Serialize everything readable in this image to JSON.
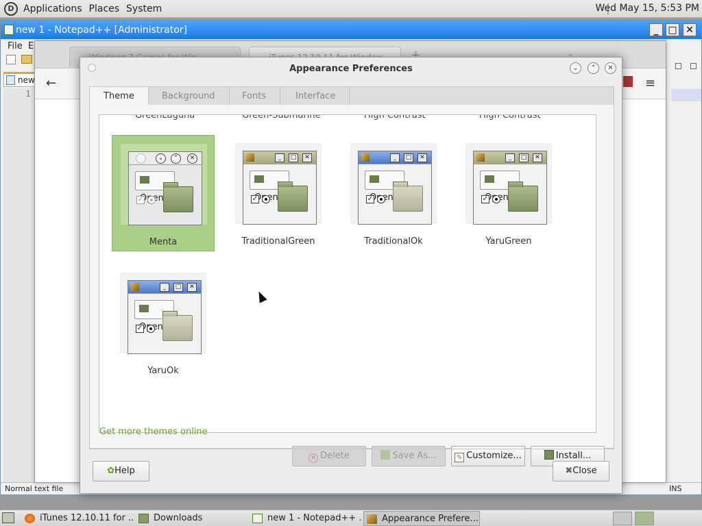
{
  "top_panel": {
    "menus": [
      "Applications",
      "Places",
      "System"
    ],
    "clock": "Wed May 15,  5:53 PM"
  },
  "notepad": {
    "title": "new 1 - Notepad++ [Administrator]",
    "menu": [
      "File",
      "Ed"
    ],
    "tab_label": "new",
    "line_number": "1",
    "status_left": "Normal text file",
    "status_right": "INS"
  },
  "browser": {
    "tabs": [
      "Windows 7 Games for Win...",
      "iTunes 12.10.11 for Window..."
    ]
  },
  "dialog": {
    "title": "Appearance Preferences",
    "tabs": [
      "Theme",
      "Background",
      "Fonts",
      "Interface"
    ],
    "cut_off_names": [
      "GreenLaguna",
      "Green-Submarine",
      "High Contrast",
      "High Contrast"
    ],
    "themes": [
      {
        "name": "Menta",
        "selected": true
      },
      {
        "name": "TraditionalGreen",
        "selected": false
      },
      {
        "name": "TraditionalOk",
        "selected": false
      },
      {
        "name": "YaruGreen",
        "selected": false
      },
      {
        "name": "YaruOk",
        "selected": false
      }
    ],
    "thumb_button": "Open",
    "buttons": {
      "delete": "Delete",
      "save_as": "Save As...",
      "customize": "Customize...",
      "install": "Install..."
    },
    "more_themes_link": "Get more themes online",
    "help": "Help",
    "close": "Close",
    "link_color": "#6aa521",
    "selection_color": "#a8cf85"
  },
  "taskbar": {
    "tasks": [
      {
        "label": "iTunes 12.10.11 for ...",
        "icon": "firefox-icon"
      },
      {
        "label": "Downloads",
        "icon": "folder-icon"
      },
      {
        "label": "new 1 - Notepad++ ...",
        "icon": "notepad-icon"
      },
      {
        "label": "Appearance Prefere...",
        "icon": "appearance-icon"
      }
    ]
  }
}
